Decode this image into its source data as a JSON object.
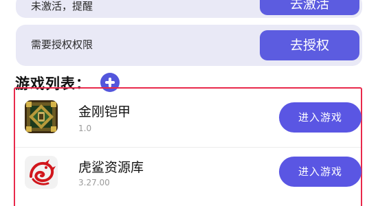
{
  "top_card": {
    "text": "未激活，提醒",
    "button_label": "去激活"
  },
  "auth_card": {
    "text": "需要授权权限",
    "button_label": "去授权"
  },
  "game_list": {
    "title": "游戏列表：",
    "add_icon": "plus-circle-icon",
    "games": [
      {
        "name": "金刚铠甲",
        "version": "1.0",
        "button_label": "进入游戏",
        "icon": "armor-game-icon"
      },
      {
        "name": "虎鲨资源库",
        "version": "3.27.00",
        "button_label": "进入游戏",
        "icon": "red-dragon-icon"
      }
    ]
  },
  "colors": {
    "accent": "#5a56e3",
    "card_bg": "#e9e9f6",
    "frame_red": "#e8294b"
  }
}
